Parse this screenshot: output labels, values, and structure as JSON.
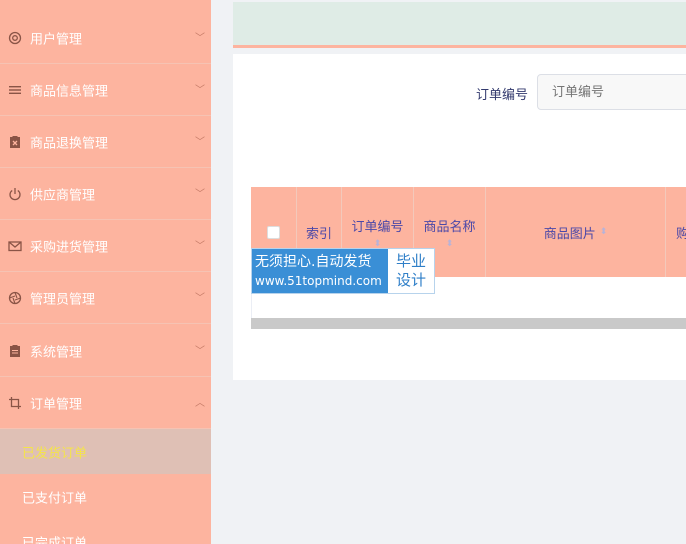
{
  "sidebar": {
    "items": [
      {
        "label": "用户管理",
        "icon": "lifebuoy-icon"
      },
      {
        "label": "商品信息管理",
        "icon": "list-icon"
      },
      {
        "label": "商品退换管理",
        "icon": "clipboard-x-icon"
      },
      {
        "label": "供应商管理",
        "icon": "power-icon"
      },
      {
        "label": "采购进货管理",
        "icon": "mail-icon"
      },
      {
        "label": "管理员管理",
        "icon": "aperture-icon"
      },
      {
        "label": "系统管理",
        "icon": "clipboard-icon"
      },
      {
        "label": "订单管理",
        "icon": "crop-icon"
      }
    ],
    "submenu": [
      {
        "label": "已发货订单",
        "active": true
      },
      {
        "label": "已支付订单",
        "active": false
      },
      {
        "label": "已完成订单",
        "active": false
      }
    ],
    "colors": {
      "background": "#fdb49f",
      "active_text": "#f4e44a"
    }
  },
  "search": {
    "label": "订单编号",
    "placeholder": "订单编号"
  },
  "table": {
    "columns": [
      "索引",
      "订单编号",
      "商品名称",
      "商品图片",
      "购"
    ]
  },
  "watermark": {
    "line1": "无须担心.自动发货",
    "line2": "www.51topmind.com",
    "right_line1": "毕业",
    "right_line2": "设计"
  }
}
